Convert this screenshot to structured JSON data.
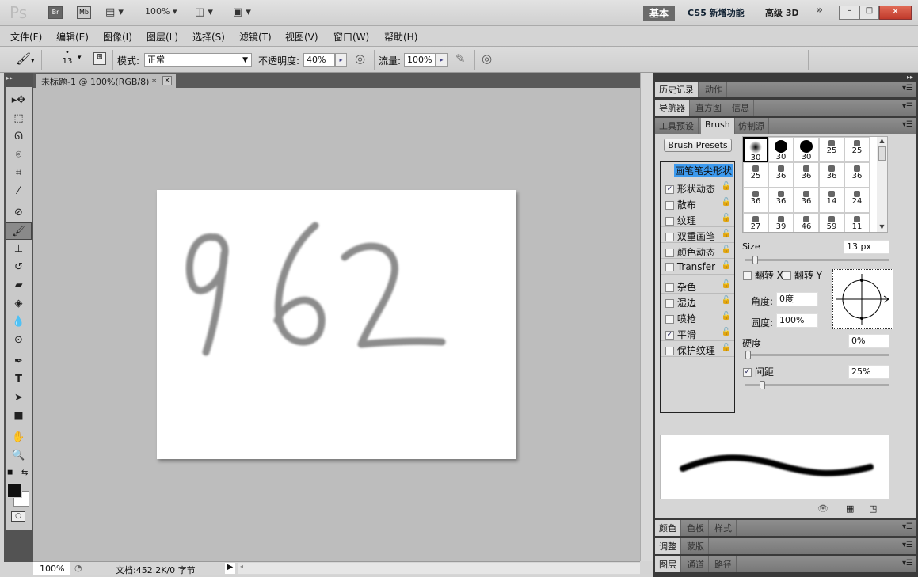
{
  "app": {
    "logo": "Ps",
    "bridge": "Br",
    "mini_bridge": "Mb",
    "zoom": "100%",
    "workspaces": [
      "基本",
      "CS5 新增功能",
      "高级 3D"
    ],
    "more": "»"
  },
  "window_controls": {
    "minimize": "–",
    "maximize": "□",
    "close": "✕"
  },
  "menu": [
    "文件(F)",
    "编辑(E)",
    "图像(I)",
    "图层(L)",
    "选择(S)",
    "滤镜(T)",
    "视图(V)",
    "窗口(W)",
    "帮助(H)"
  ],
  "options": {
    "brush_size": "13",
    "mode_label": "模式:",
    "mode_value": "正常",
    "opacity_label": "不透明度:",
    "opacity_value": "40%",
    "flow_label": "流量:",
    "flow_value": "100%"
  },
  "document": {
    "tab_title": "未标题-1 @ 100%(RGB/8) *",
    "close": "✕",
    "handwriting": "962",
    "stroke_color": "#8c8c8c"
  },
  "tools": [
    "move",
    "rect-marquee",
    "lasso",
    "quick-select",
    "crop",
    "eyedropper",
    "spot-healing",
    "brush",
    "clone-stamp",
    "history-brush",
    "eraser",
    "paint-bucket",
    "blur",
    "dodge",
    "pen",
    "type",
    "path-select",
    "rectangle",
    "hand",
    "zoom"
  ],
  "colors": {
    "foreground": "#111111",
    "background": "#ffffff"
  },
  "status": {
    "zoom": "100%",
    "doc_info": "文档:452.2K/0 字节"
  },
  "panels": {
    "group1": [
      "历史记录",
      "动作"
    ],
    "group2": [
      "导航器",
      "直方图",
      "信息"
    ],
    "group3": [
      "工具预设",
      "Brush",
      "仿制源"
    ],
    "group4": [
      "颜色",
      "色板",
      "样式"
    ],
    "group5": [
      "调整",
      "蒙版"
    ],
    "group6": [
      "图层",
      "通道",
      "路径"
    ]
  },
  "brush": {
    "presets_button": "Brush Presets",
    "tip_shape": "画笔笔尖形状",
    "options": [
      {
        "label": "形状动态",
        "checked": true
      },
      {
        "label": "散布",
        "checked": false
      },
      {
        "label": "纹理",
        "checked": false
      },
      {
        "label": "双重画笔",
        "checked": false
      },
      {
        "label": "颜色动态",
        "checked": false
      },
      {
        "label": "Transfer",
        "checked": false
      },
      {
        "label": "杂色",
        "checked": false
      },
      {
        "label": "湿边",
        "checked": false
      },
      {
        "label": "喷枪",
        "checked": false
      },
      {
        "label": "平滑",
        "checked": true
      },
      {
        "label": "保护纹理",
        "checked": false
      }
    ],
    "preset_sizes": [
      "30",
      "30",
      "30",
      "25",
      "25",
      "25",
      "36",
      "36",
      "36",
      "36",
      "36",
      "36",
      "36",
      "14",
      "24",
      "27",
      "39",
      "46",
      "59",
      "11"
    ],
    "size_label": "Size",
    "size_value": "13 px",
    "size_slider": 0.05,
    "flip_x": "翻转 X",
    "flip_y": "翻转 Y",
    "angle_label": "角度:",
    "angle_value": "0度",
    "roundness_label": "圆度:",
    "roundness_value": "100%",
    "hardness_label": "硬度",
    "hardness_value": "0%",
    "hardness_slider": 0,
    "spacing_label": "间距",
    "spacing_checked": true,
    "spacing_value": "25%",
    "spacing_slider": 0.1
  }
}
